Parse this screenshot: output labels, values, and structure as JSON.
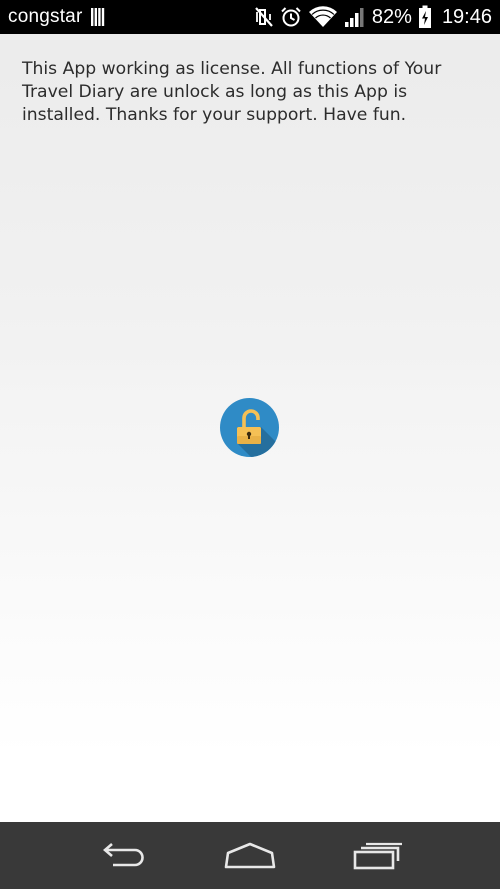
{
  "status_bar": {
    "carrier": "congstar",
    "battery_percent": "82%",
    "time": "19:46",
    "icons": [
      "sim-card-icon",
      "vibrate-off-icon",
      "alarm-icon",
      "wifi-icon",
      "cell-signal-icon",
      "battery-icon"
    ]
  },
  "main": {
    "message": "This App working as license. All functions of Your Travel Diary are unlock as long as this App is installed. Thanks for your support. Have fun.",
    "lock_icon": "unlocked-padlock-icon",
    "colors": {
      "badge": "#2f8bc6",
      "padlock": "#f5c055"
    }
  },
  "nav_bar": {
    "buttons": [
      "back-icon",
      "home-icon",
      "recent-apps-icon"
    ]
  }
}
